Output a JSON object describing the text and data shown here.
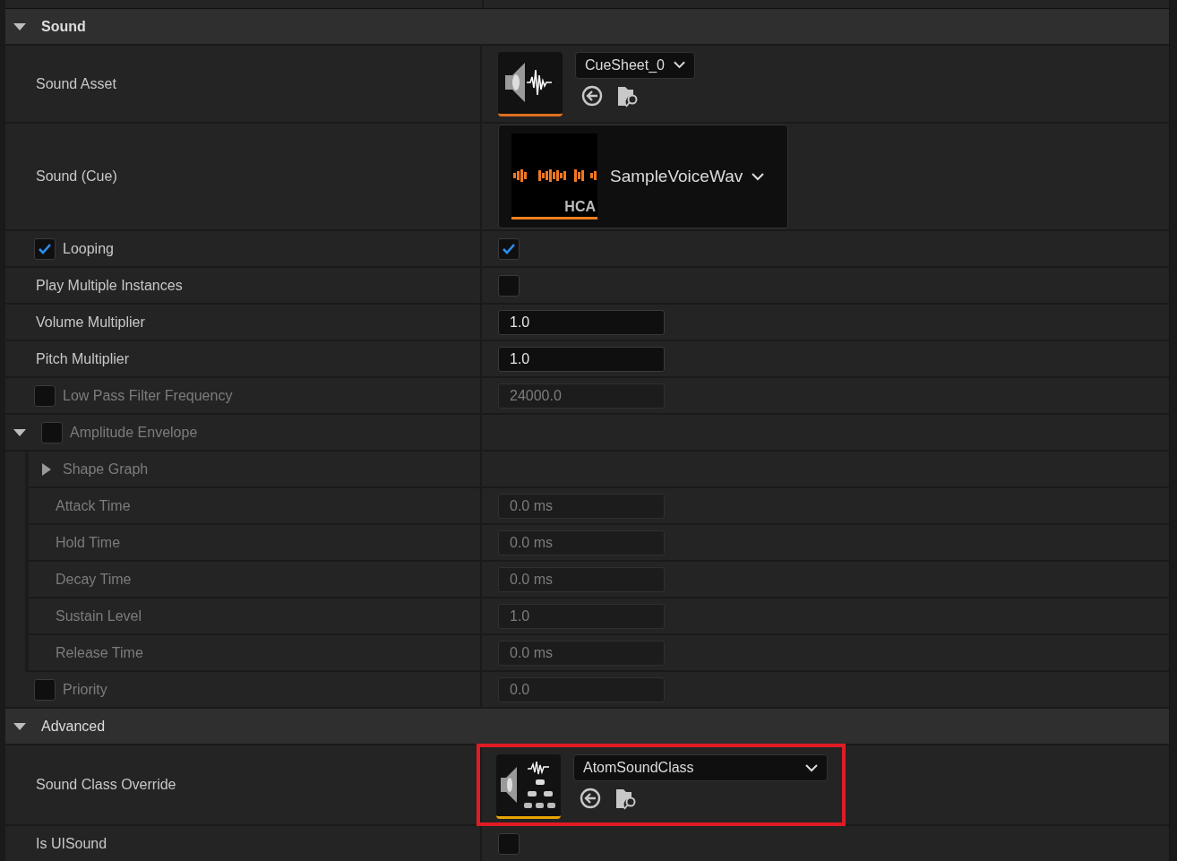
{
  "categories": [
    {
      "title": "Sound",
      "expanded": true,
      "rows": [
        {
          "kind": "asset",
          "name": "Sound Asset",
          "thumbnail": {
            "kind": "wave"
          },
          "value": "CueSheet_0"
        },
        {
          "kind": "cue",
          "name": "Sound (Cue)",
          "badge": "HCA",
          "value": "SampleVoiceWav"
        },
        {
          "kind": "checkbox",
          "name": "Looping",
          "edit_condition": {
            "checked": true
          },
          "enabled": true,
          "checked": true
        },
        {
          "kind": "checkbox",
          "name": "Play Multiple Instances",
          "enabled": true,
          "checked": false
        },
        {
          "kind": "number",
          "name": "Volume Multiplier",
          "enabled": true,
          "value": "1.0"
        },
        {
          "kind": "number",
          "name": "Pitch Multiplier",
          "enabled": true,
          "value": "1.0"
        },
        {
          "kind": "number",
          "name": "Low Pass Filter Frequency",
          "edit_condition": {
            "checked": false
          },
          "enabled": false,
          "value": "24000.0"
        },
        {
          "kind": "group",
          "name": "Amplitude Envelope",
          "edit_condition": {
            "checked": false
          },
          "enabled": false,
          "expanded": true,
          "children": [
            {
              "kind": "group",
              "name": "Shape Graph",
              "enabled": false,
              "expanded": false
            },
            {
              "kind": "number",
              "name": "Attack Time",
              "enabled": false,
              "value": "0.0 ms"
            },
            {
              "kind": "number",
              "name": "Hold Time",
              "enabled": false,
              "value": "0.0 ms"
            },
            {
              "kind": "number",
              "name": "Decay Time",
              "enabled": false,
              "value": "0.0 ms"
            },
            {
              "kind": "number",
              "name": "Sustain Level",
              "enabled": false,
              "value": "1.0"
            },
            {
              "kind": "number",
              "name": "Release Time",
              "enabled": false,
              "value": "0.0 ms"
            }
          ]
        },
        {
          "kind": "number",
          "name": "Priority",
          "edit_condition": {
            "checked": false
          },
          "enabled": false,
          "value": "0.0"
        }
      ]
    },
    {
      "title": "Advanced",
      "expanded": true,
      "rows": [
        {
          "kind": "asset",
          "name": "Sound Class Override",
          "thumbnail": {
            "kind": "class"
          },
          "value": "AtomSoundClass",
          "highlighted": true
        },
        {
          "kind": "checkbox",
          "name": "Is UISound",
          "enabled": true,
          "checked": false
        }
      ]
    }
  ]
}
